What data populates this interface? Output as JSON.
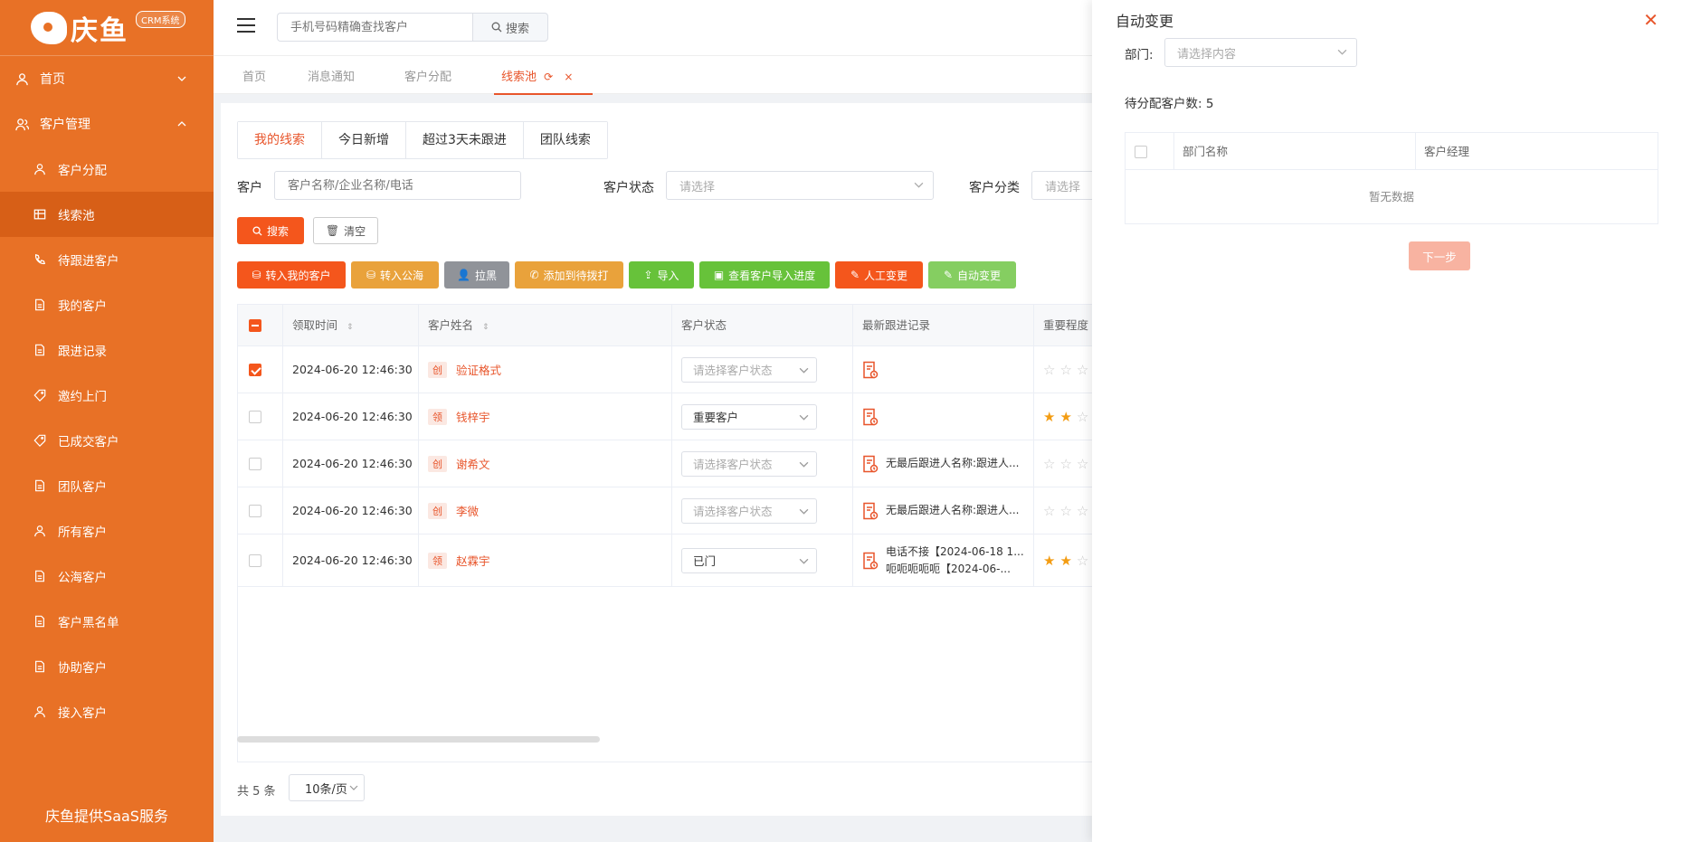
{
  "sidebar": {
    "logo_text": "庆鱼",
    "logo_badge": "CRM系统",
    "top_items": [
      {
        "label": "首页"
      },
      {
        "label": "客户管理"
      }
    ],
    "sub_items": [
      {
        "label": "客户分配"
      },
      {
        "label": "线索池"
      },
      {
        "label": "待跟进客户"
      },
      {
        "label": "我的客户"
      },
      {
        "label": "跟进记录"
      },
      {
        "label": "邀约上门"
      },
      {
        "label": "已成交客户"
      },
      {
        "label": "团队客户"
      },
      {
        "label": "所有客户"
      },
      {
        "label": "公海客户"
      },
      {
        "label": "客户黑名单"
      },
      {
        "label": "协助客户"
      },
      {
        "label": "接入客户"
      }
    ],
    "footer": "庆鱼提供SaaS服务"
  },
  "header": {
    "search_placeholder": "手机号码精确查找客户",
    "search_button": "搜索"
  },
  "tabs": [
    {
      "label": "首页"
    },
    {
      "label": "消息通知"
    },
    {
      "label": "客户分配"
    },
    {
      "label": "线索池"
    }
  ],
  "subtabs": [
    {
      "label": "我的线索"
    },
    {
      "label": "今日新增"
    },
    {
      "label": "超过3天未跟进"
    },
    {
      "label": "团队线索"
    }
  ],
  "filters": {
    "customer_label": "客户",
    "customer_placeholder": "客户名称/企业名称/电话",
    "status_label": "客户状态",
    "status_placeholder": "请选择",
    "category_label": "客户分类",
    "category_placeholder": "请选择"
  },
  "actions": {
    "search": "搜索",
    "clear": "清空",
    "to_mine": "转入我的客户",
    "to_sea": "转入公海",
    "blacklist": "拉黑",
    "to_call": "添加到待拨打",
    "import": "导入",
    "import_progress": "查看客户导入进度",
    "manual_change": "人工变更",
    "auto_change": "自动变更"
  },
  "action_colors": {
    "to_mine": "#f4561c",
    "to_sea": "#e9a23b",
    "blacklist": "#909399",
    "to_call": "#e9a23b",
    "import": "#67c23a",
    "import_progress": "#67c23a",
    "manual_change": "#f4561c",
    "auto_change": "#85ce61"
  },
  "table": {
    "headers": {
      "time": "领取时间",
      "name": "客户姓名",
      "status": "客户状态",
      "record": "最新跟进记录",
      "importance": "重要程度"
    },
    "rows": [
      {
        "time": "2024-06-20 12:46:30",
        "tag": "创",
        "name": "验证格式",
        "status": "请选择客户状态",
        "status_filled": false,
        "record1": "",
        "record2": "",
        "stars": 0,
        "checked": true
      },
      {
        "time": "2024-06-20 12:46:30",
        "tag": "领",
        "name": "钱梓宇",
        "status": "重要客户",
        "status_filled": true,
        "record1": "",
        "record2": "",
        "stars": 2,
        "checked": false
      },
      {
        "time": "2024-06-20 12:46:30",
        "tag": "创",
        "name": "谢希文",
        "status": "请选择客户状态",
        "status_filled": false,
        "record1": "无最后跟进人名称:跟进人...",
        "record2": "",
        "stars": 0,
        "checked": false
      },
      {
        "time": "2024-06-20 12:46:30",
        "tag": "创",
        "name": "李微",
        "status": "请选择客户状态",
        "status_filled": false,
        "record1": "无最后跟进人名称:跟进人...",
        "record2": "",
        "stars": 0,
        "checked": false
      },
      {
        "time": "2024-06-20 12:46:30",
        "tag": "领",
        "name": "赵霖宇",
        "status": "已门",
        "status_filled": true,
        "record1": "电话不接【2024-06-18 1...",
        "record2": "呃呃呃呃呃【2024-06-...",
        "stars": 2,
        "checked": false
      }
    ]
  },
  "pagination": {
    "total": "共 5 条",
    "page_size": "10条/页"
  },
  "drawer": {
    "title": "自动变更",
    "dept_label": "部门:",
    "dept_placeholder": "请选择内容",
    "pending_label": "待分配客户数: 5",
    "col_dept": "部门名称",
    "col_manager": "客户经理",
    "empty": "暂无数据",
    "next": "下一步"
  }
}
